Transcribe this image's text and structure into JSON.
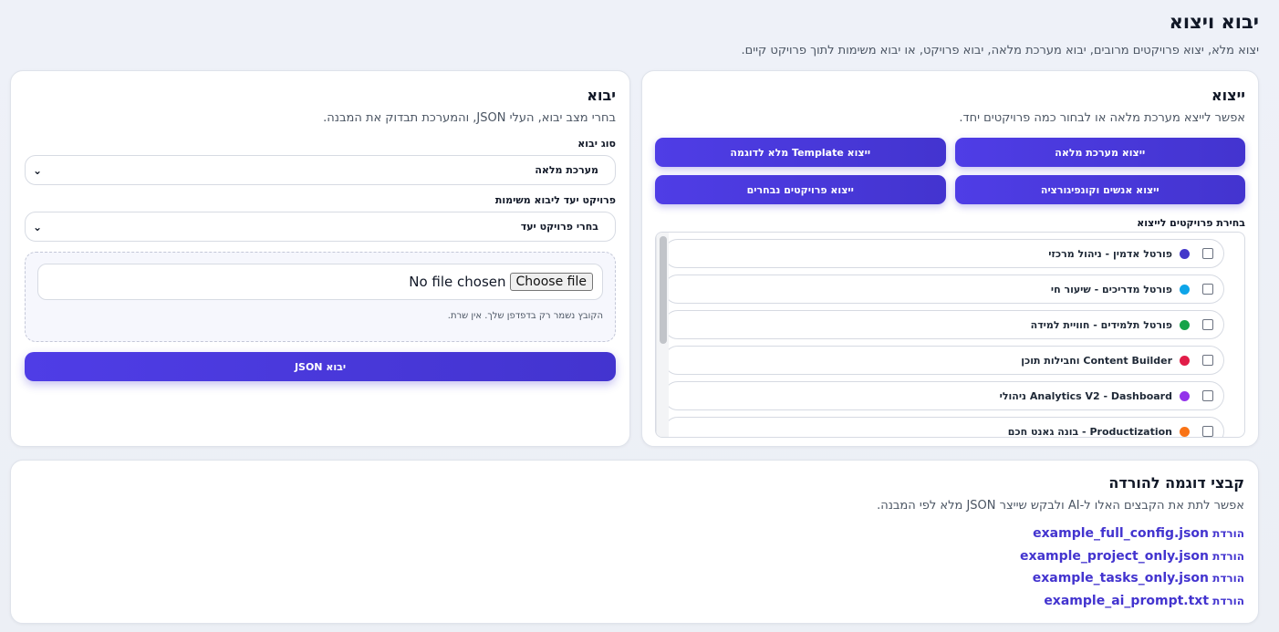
{
  "header": {
    "title": "יבוא ויצוא",
    "subtitle": "יצוא מלא, יצוא פרויקטים מרובים, יבוא מערכת מלאה, יבוא פרויקט, או יבוא משימות לתוך פרויקט קיים."
  },
  "export": {
    "title": "ייצוא",
    "subtitle": "אפשר לייצא מערכת מלאה או לבחור כמה פרויקטים יחד.",
    "buttons": {
      "full_system": "ייצוא מערכת מלאה",
      "template_example": "ייצוא Template מלא לדוגמה",
      "people_config": "ייצוא אנשים וקונפיגורציה",
      "selected_projects": "ייצוא פרויקטים נבחרים"
    },
    "list_label": "בחירת פרויקטים לייצוא",
    "projects": [
      {
        "label": "פורטל אדמין - ניהול מרכזי",
        "color": "#4338ca"
      },
      {
        "label": "פורטל מדריכים - שיעור חי",
        "color": "#0ea5e9"
      },
      {
        "label": "פורטל תלמידים - חוויית למידה",
        "color": "#16a34a"
      },
      {
        "label": "Content Builder וחבילות תוכן",
        "color": "#e11d48"
      },
      {
        "label": "Analytics V2 - Dashboard ניהולי",
        "color": "#9333ea"
      },
      {
        "label": "Productization - בונה גאנט חכם",
        "color": "#f97316"
      }
    ]
  },
  "import": {
    "title": "יבוא",
    "subtitle": "בחרי מצב יבוא, העלי JSON, והמערכת תבדוק את המבנה.",
    "type_label": "סוג יבוא",
    "type_value": "מערכת מלאה",
    "target_label": "פרויקט יעד ליבוא משימות",
    "target_value": "בחרי פרויקט יעד",
    "file_button": "Choose file",
    "file_status": "No file chosen",
    "note": "הקובץ נשמר רק בדפדפן שלך. אין שרת.",
    "submit": "יבוא JSON"
  },
  "samples": {
    "title": "קבצי דוגמה להורדה",
    "subtitle": "אפשר לתת את הקבצים האלו ל-AI ולבקש שייצר JSON מלא לפי המבנה.",
    "prefix": "הורדת",
    "files": [
      "example_full_config.json",
      "example_project_only.json",
      "example_tasks_only.json",
      "example_ai_prompt.txt"
    ]
  }
}
